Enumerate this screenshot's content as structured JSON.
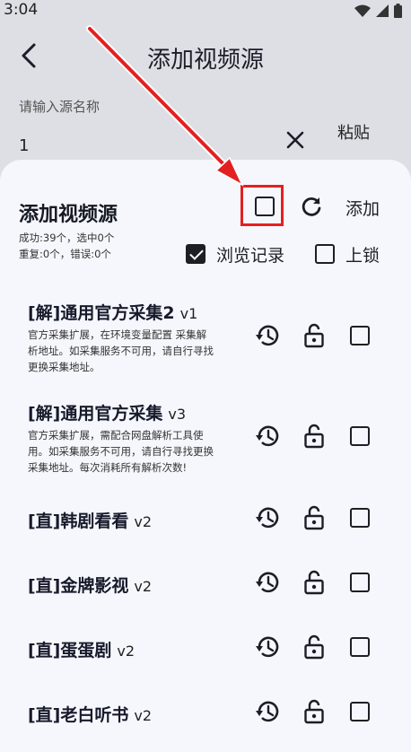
{
  "status_bar": {
    "time": "3:04"
  },
  "app_bar": {
    "title": "添加视频源"
  },
  "form": {
    "label": "请输入源名称",
    "value": "1",
    "paste_label": "粘贴"
  },
  "sheet": {
    "title": "添加视频源",
    "stats_line1": "成功:39个，选中0个",
    "stats_line2": "重复:0个，错误:0个",
    "add_label": "添加",
    "history_label": "浏览记录",
    "lock_label": "上锁"
  },
  "items": [
    {
      "title": "[解]通用官方采集2",
      "version": "v1",
      "desc_lines": [
        "官方采集扩展，在环境变量配置 采集解",
        "析地址。如采集服务不可用，请自行寻找",
        "更换采集地址。"
      ]
    },
    {
      "title": "[解]通用官方采集",
      "version": "v3",
      "desc_lines": [
        "官方采集扩展，需配合网盘解析工具使",
        "用。如采集服务不可用，请自行寻找更换",
        "采集地址。每次消耗所有解析次数!"
      ]
    },
    {
      "title": "[直]韩剧看看",
      "version": "v2"
    },
    {
      "title": "[直]金牌影视",
      "version": "v2"
    },
    {
      "title": "[直]蛋蛋剧",
      "version": "v2"
    },
    {
      "title": "[直]老白听书",
      "version": "v2"
    }
  ],
  "colors": {
    "annotation": "#e32020",
    "sheet_bg": "#f6f7fd",
    "page_bg": "#dedfe5"
  }
}
